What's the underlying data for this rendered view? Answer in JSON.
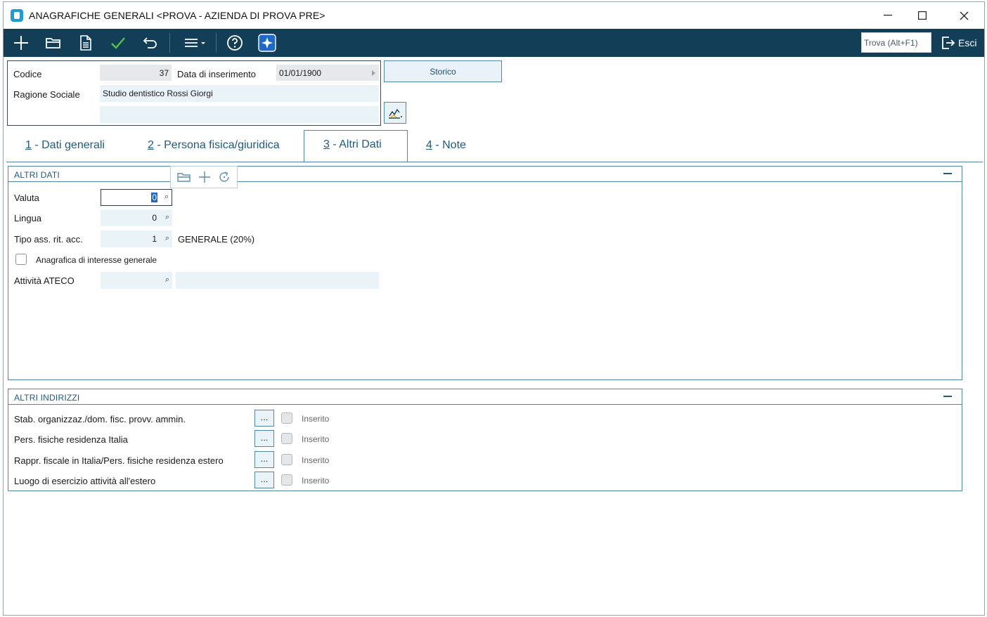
{
  "window": {
    "title": "ANAGRAFICHE GENERALI <PROVA - AZIENDA DI PROVA PRE>",
    "minimize_glyph": "—",
    "maximize_glyph": "☐",
    "close_glyph": "✕"
  },
  "toolbar": {
    "icons": [
      "add-icon",
      "open-folder-icon",
      "document-icon",
      "confirm-check-icon",
      "undo-icon",
      "menu-icon",
      "help-icon",
      "sparkle-icon"
    ],
    "find_label": "Trova (Alt+F1)",
    "exit_label": "Esci",
    "accent": "#133e58"
  },
  "header": {
    "codice_label": "Codice",
    "codice_value": "37",
    "data_inserimento_label": "Data di inserimento",
    "data_inserimento_value": "01/01/1900",
    "ragione_sociale_label": "Ragione Sociale",
    "ragione_sociale_value": "Studio dentistico Rossi Giorgi",
    "ragione_sociale_line2": "",
    "storico_label": "Storico"
  },
  "tabs": [
    {
      "num": "1",
      "label": " - Dati generali",
      "active": false
    },
    {
      "num": "2",
      "label": " - Persona fisica/giuridica",
      "active": false
    },
    {
      "num": "3",
      "label": " - Altri Dati",
      "active": true
    },
    {
      "num": "4",
      "label": " - Note",
      "active": false
    }
  ],
  "altri_dati": {
    "title": "ALTRI DATI",
    "valuta_label": "Valuta",
    "valuta_value": "0",
    "lingua_label": "Lingua",
    "lingua_value": "0",
    "tipo_label": "Tipo ass. rit. acc.",
    "tipo_value": "1",
    "tipo_desc": "GENERALE (20%)",
    "interesse_label": "Anagrafica di interesse generale",
    "interesse_checked": false,
    "ateco_label": "Attività ATECO",
    "ateco_value": "",
    "ateco_desc": ""
  },
  "altri_indirizzi": {
    "title": "ALTRI INDIRIZZI",
    "button_label": "...",
    "rows": [
      {
        "label": "Stab. organizzaz./dom. fisc. provv. ammin.",
        "status": "Inserito"
      },
      {
        "label": "Pers. fisiche residenza Italia",
        "status": "Inserito"
      },
      {
        "label": "Rappr. fiscale in Italia/Pers. fisiche residenza estero",
        "status": "Inserito"
      },
      {
        "label": "Luogo di esercizio attività all'estero",
        "status": "Inserito"
      }
    ]
  }
}
